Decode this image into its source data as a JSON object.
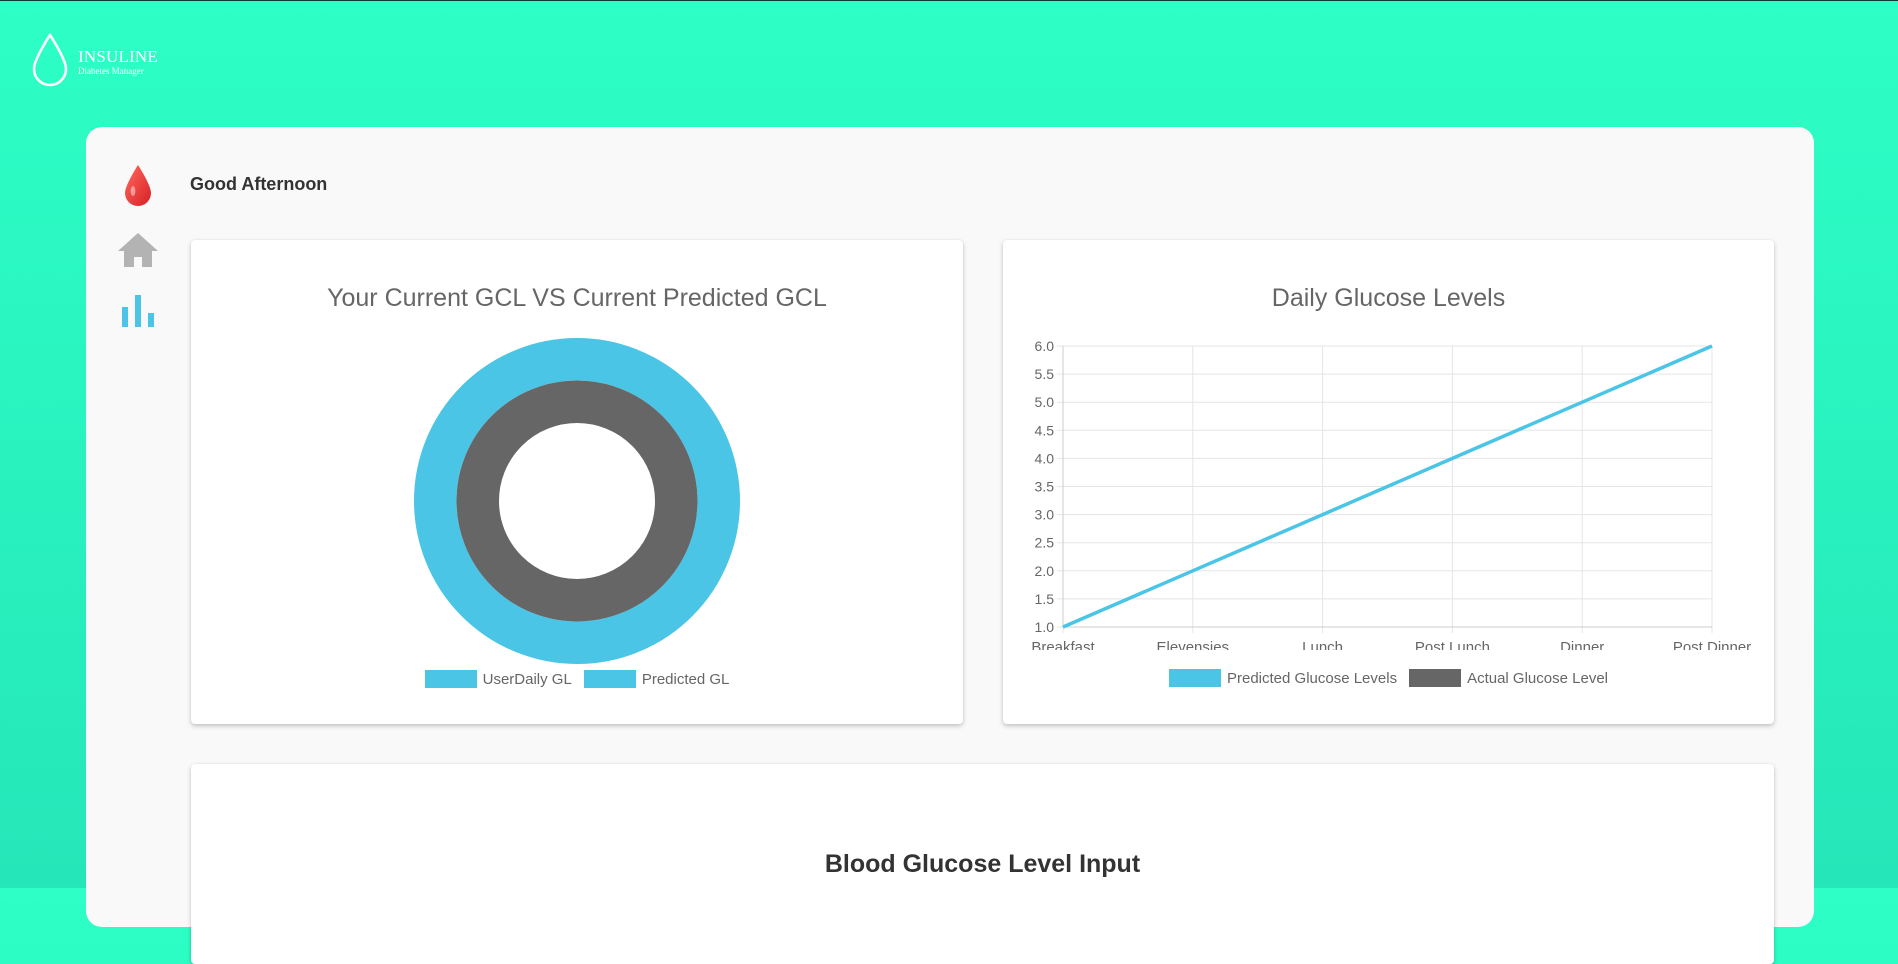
{
  "brand": {
    "name": "INSULINE",
    "tagline": "Diabetes Manager"
  },
  "nav": {
    "items": [
      {
        "icon": "blood-drop-icon",
        "color": "#e53935"
      },
      {
        "icon": "home-icon",
        "color": "#b0b0b0"
      },
      {
        "icon": "bar-chart-icon",
        "color": "#4bc5e6"
      }
    ]
  },
  "greeting": "Good Afternoon",
  "donut_card": {
    "title": "Your Current GCL VS Current Predicted GCL",
    "legend": [
      {
        "label": "UserDaily GL",
        "color": "#4bc5e6"
      },
      {
        "label": "Predicted GL",
        "color": "#4bc5e6"
      }
    ]
  },
  "line_card": {
    "title": "Daily Glucose Levels",
    "legend": [
      {
        "label": "Predicted Glucose Levels",
        "color": "#4bc5e6"
      },
      {
        "label": "Actual Glucose Level",
        "color": "#666666"
      }
    ]
  },
  "input_card": {
    "title": "Blood Glucose Level Input"
  },
  "chart_data": [
    {
      "type": "pie",
      "variant": "doughnut",
      "title": "Your Current GCL VS Current Predicted GCL",
      "series": [
        {
          "name": "UserDaily GL",
          "color": "#4bc5e6",
          "values": [
            1
          ]
        },
        {
          "name": "Predicted GL",
          "color": "#666666",
          "values": [
            1
          ]
        }
      ],
      "legend": "bottom"
    },
    {
      "type": "line",
      "title": "Daily Glucose Levels",
      "categories": [
        "Breakfast",
        "Elevensies",
        "Lunch",
        "Post Lunch",
        "Dinner",
        "Post Dinner"
      ],
      "series": [
        {
          "name": "Predicted Glucose Levels",
          "color": "#4bc5e6",
          "values": [
            1,
            2,
            3,
            4,
            5,
            6
          ]
        },
        {
          "name": "Actual Glucose Level",
          "color": "#666666",
          "values": []
        }
      ],
      "ylim": [
        1,
        6
      ],
      "yticks": [
        "1.0",
        "1.5",
        "2.0",
        "2.5",
        "3.0",
        "3.5",
        "4.0",
        "4.5",
        "5.0",
        "5.5",
        "6.0"
      ],
      "grid": true,
      "legend": "bottom"
    }
  ]
}
